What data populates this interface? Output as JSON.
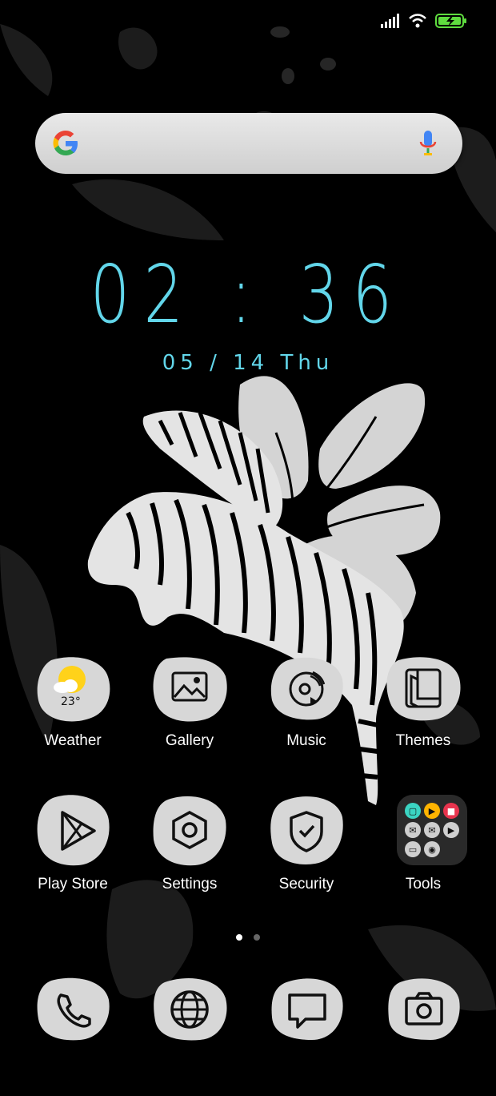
{
  "status_bar": {
    "signal_icon": "signal-bars-icon",
    "wifi_icon": "wifi-icon",
    "battery_icon": "battery-charging-icon"
  },
  "search_bar": {
    "logo_icon": "google-g-icon",
    "mic_icon": "microphone-icon"
  },
  "clock": {
    "time": "02 : 36",
    "date": "05 / 14  Thu"
  },
  "apps": [
    {
      "label": "Weather",
      "icon": "weather-sun-cloud-icon",
      "temperature": "23°"
    },
    {
      "label": "Gallery",
      "icon": "image-icon"
    },
    {
      "label": "Music",
      "icon": "music-disc-icon"
    },
    {
      "label": "Themes",
      "icon": "themes-icon"
    },
    {
      "label": "Play Store",
      "icon": "play-store-icon"
    },
    {
      "label": "Settings",
      "icon": "settings-hexagon-icon"
    },
    {
      "label": "Security",
      "icon": "shield-check-icon"
    },
    {
      "label": "Tools",
      "icon": "folder-icon"
    }
  ],
  "page_indicator": {
    "pages": 2,
    "current": 1
  },
  "dock": [
    {
      "icon": "phone-icon"
    },
    {
      "icon": "globe-icon"
    },
    {
      "icon": "message-icon"
    },
    {
      "icon": "camera-icon"
    }
  ],
  "colors": {
    "clock": "#62d6ea",
    "background": "#000000",
    "icon_blob": "#d7d7d7"
  }
}
